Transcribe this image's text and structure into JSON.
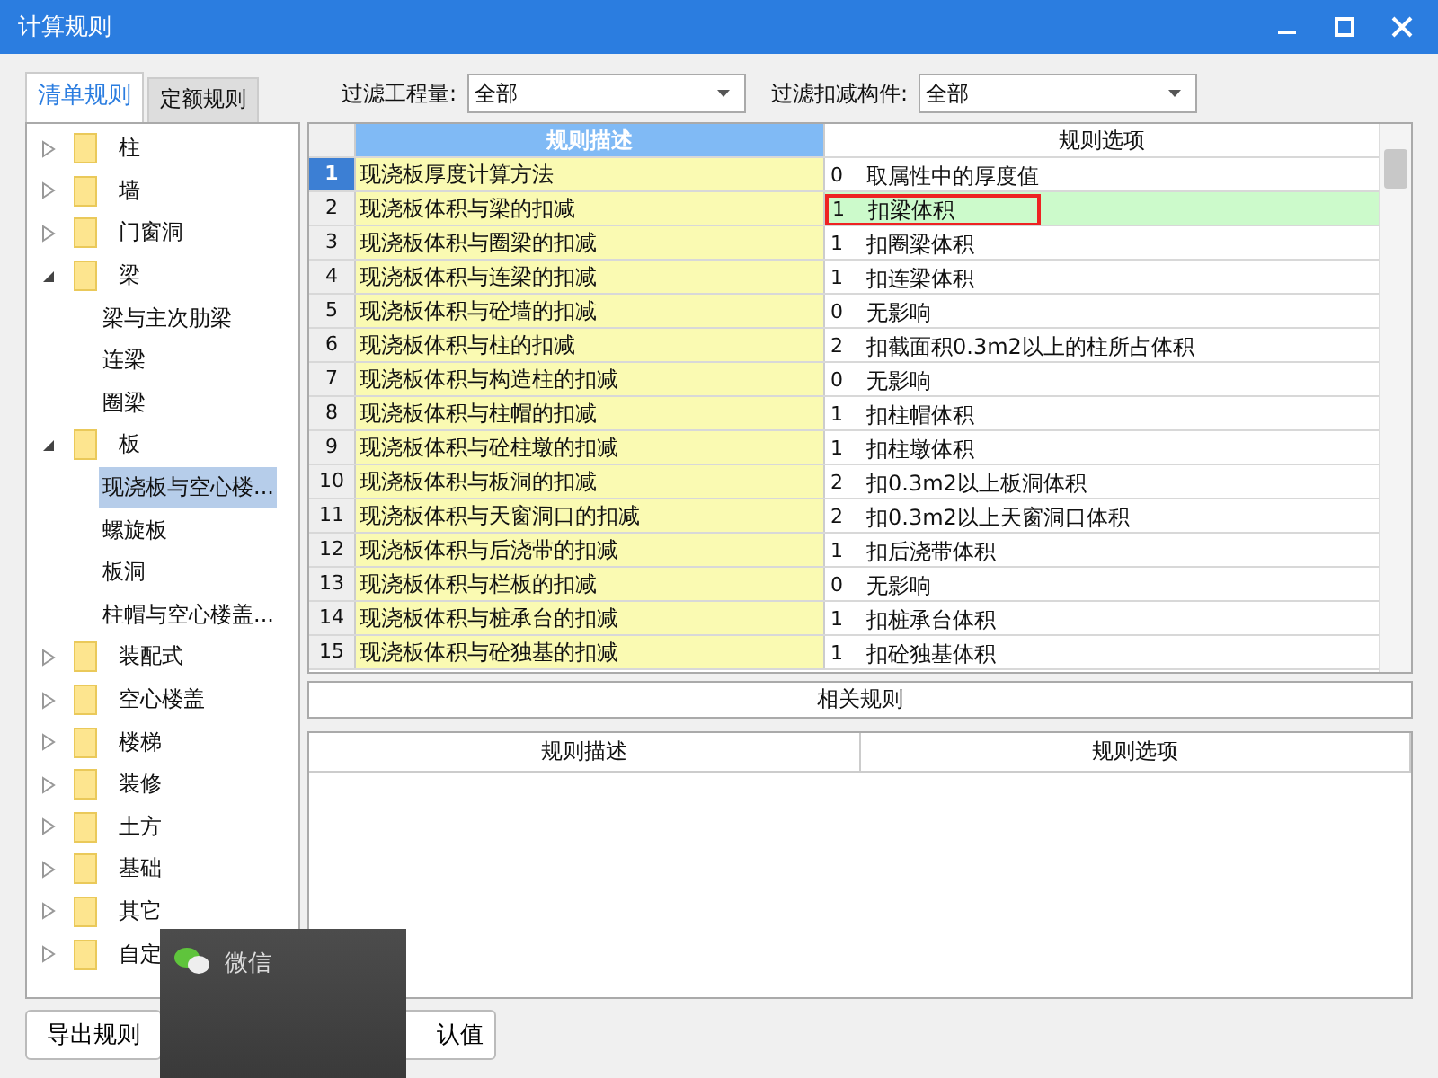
{
  "window": {
    "title": "计算规则"
  },
  "tabs": [
    {
      "label": "清单规则",
      "selected": true
    },
    {
      "label": "定额规则",
      "selected": false
    }
  ],
  "filters": [
    {
      "label": "过滤工程量:",
      "value": "全部"
    },
    {
      "label": "过滤扣减构件:",
      "value": "全部"
    }
  ],
  "tree": [
    {
      "label": "柱",
      "expanded": false,
      "selected": false
    },
    {
      "label": "墙",
      "expanded": false,
      "selected": false
    },
    {
      "label": "门窗洞",
      "expanded": false,
      "selected": false
    },
    {
      "label": "梁",
      "expanded": true,
      "selected": false,
      "children": [
        {
          "label": "梁与主次肋梁",
          "selected": false
        },
        {
          "label": "连梁",
          "selected": false
        },
        {
          "label": "圈梁",
          "selected": false
        }
      ]
    },
    {
      "label": "板",
      "expanded": true,
      "selected": false,
      "children": [
        {
          "label": "现浇板与空心楼...",
          "selected": true
        },
        {
          "label": "螺旋板",
          "selected": false
        },
        {
          "label": "板洞",
          "selected": false
        },
        {
          "label": "柱帽与空心楼盖...",
          "selected": false
        }
      ]
    },
    {
      "label": "装配式",
      "expanded": false,
      "selected": false
    },
    {
      "label": "空心楼盖",
      "expanded": false,
      "selected": false
    },
    {
      "label": "楼梯",
      "expanded": false,
      "selected": false
    },
    {
      "label": "装修",
      "expanded": false,
      "selected": false
    },
    {
      "label": "土方",
      "expanded": false,
      "selected": false
    },
    {
      "label": "基础",
      "expanded": false,
      "selected": false
    },
    {
      "label": "其它",
      "expanded": false,
      "selected": false
    },
    {
      "label": "自定",
      "expanded": false,
      "selected": false
    }
  ],
  "rules_table": {
    "columns": [
      "规则描述",
      "规则选项"
    ],
    "rows": [
      {
        "number": "1",
        "description": "现浇板厚度计算方法",
        "code": "0",
        "option": "取属性中的厚度值",
        "selected": true,
        "focused": false
      },
      {
        "number": "2",
        "description": "现浇板体积与梁的扣减",
        "code": "1",
        "option": "扣梁体积",
        "selected": false,
        "focused": true
      },
      {
        "number": "3",
        "description": "现浇板体积与圈梁的扣减",
        "code": "1",
        "option": "扣圈梁体积",
        "selected": false,
        "focused": false
      },
      {
        "number": "4",
        "description": "现浇板体积与连梁的扣减",
        "code": "1",
        "option": "扣连梁体积",
        "selected": false,
        "focused": false
      },
      {
        "number": "5",
        "description": "现浇板体积与砼墙的扣减",
        "code": "0",
        "option": "无影响",
        "selected": false,
        "focused": false
      },
      {
        "number": "6",
        "description": "现浇板体积与柱的扣减",
        "code": "2",
        "option": "扣截面积0.3m2以上的柱所占体积",
        "selected": false,
        "focused": false
      },
      {
        "number": "7",
        "description": "现浇板体积与构造柱的扣减",
        "code": "0",
        "option": "无影响",
        "selected": false,
        "focused": false
      },
      {
        "number": "8",
        "description": "现浇板体积与柱帽的扣减",
        "code": "1",
        "option": "扣柱帽体积",
        "selected": false,
        "focused": false
      },
      {
        "number": "9",
        "description": "现浇板体积与砼柱墩的扣减",
        "code": "1",
        "option": "扣柱墩体积",
        "selected": false,
        "focused": false
      },
      {
        "number": "10",
        "description": "现浇板体积与板洞的扣减",
        "code": "2",
        "option": "扣0.3m2以上板洞体积",
        "selected": false,
        "focused": false
      },
      {
        "number": "11",
        "description": "现浇板体积与天窗洞口的扣减",
        "code": "2",
        "option": "扣0.3m2以上天窗洞口体积",
        "selected": false,
        "focused": false
      },
      {
        "number": "12",
        "description": "现浇板体积与后浇带的扣减",
        "code": "1",
        "option": "扣后浇带体积",
        "selected": false,
        "focused": false
      },
      {
        "number": "13",
        "description": "现浇板体积与栏板的扣减",
        "code": "0",
        "option": "无影响",
        "selected": false,
        "focused": false
      },
      {
        "number": "14",
        "description": "现浇板体积与桩承台的扣减",
        "code": "1",
        "option": "扣桩承台体积",
        "selected": false,
        "focused": false
      },
      {
        "number": "15",
        "description": "现浇板体积与砼独基的扣减",
        "code": "1",
        "option": "扣砼独基体积",
        "selected": false,
        "focused": false
      }
    ]
  },
  "related_rules": {
    "title": "相关规则",
    "columns": [
      "规则描述",
      "规则选项"
    ]
  },
  "buttons": [
    {
      "label": "导出规则"
    },
    {
      "label": "认值"
    }
  ],
  "notification": {
    "app": "微信"
  }
}
